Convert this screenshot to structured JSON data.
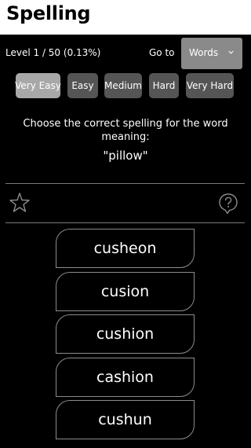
{
  "app": {
    "title": "Spelling"
  },
  "level": {
    "text": "Level 1 / 50 (0.13%)"
  },
  "goto": {
    "label": "Go to",
    "selected": "Words"
  },
  "difficulty": [
    {
      "label": "Very Easy",
      "active": true
    },
    {
      "label": "Easy",
      "active": false
    },
    {
      "label": "Medium",
      "active": false
    },
    {
      "label": "Hard",
      "active": false
    },
    {
      "label": "Very Hard",
      "active": false
    }
  ],
  "question": {
    "prompt": "Choose the correct spelling for the word meaning:",
    "word": "\"pillow\""
  },
  "options": [
    "cusheon",
    "cusion",
    "cushion",
    "cashion",
    "cushun"
  ],
  "icons": {
    "favorite": "star-icon",
    "help": "help-bubble-icon"
  }
}
